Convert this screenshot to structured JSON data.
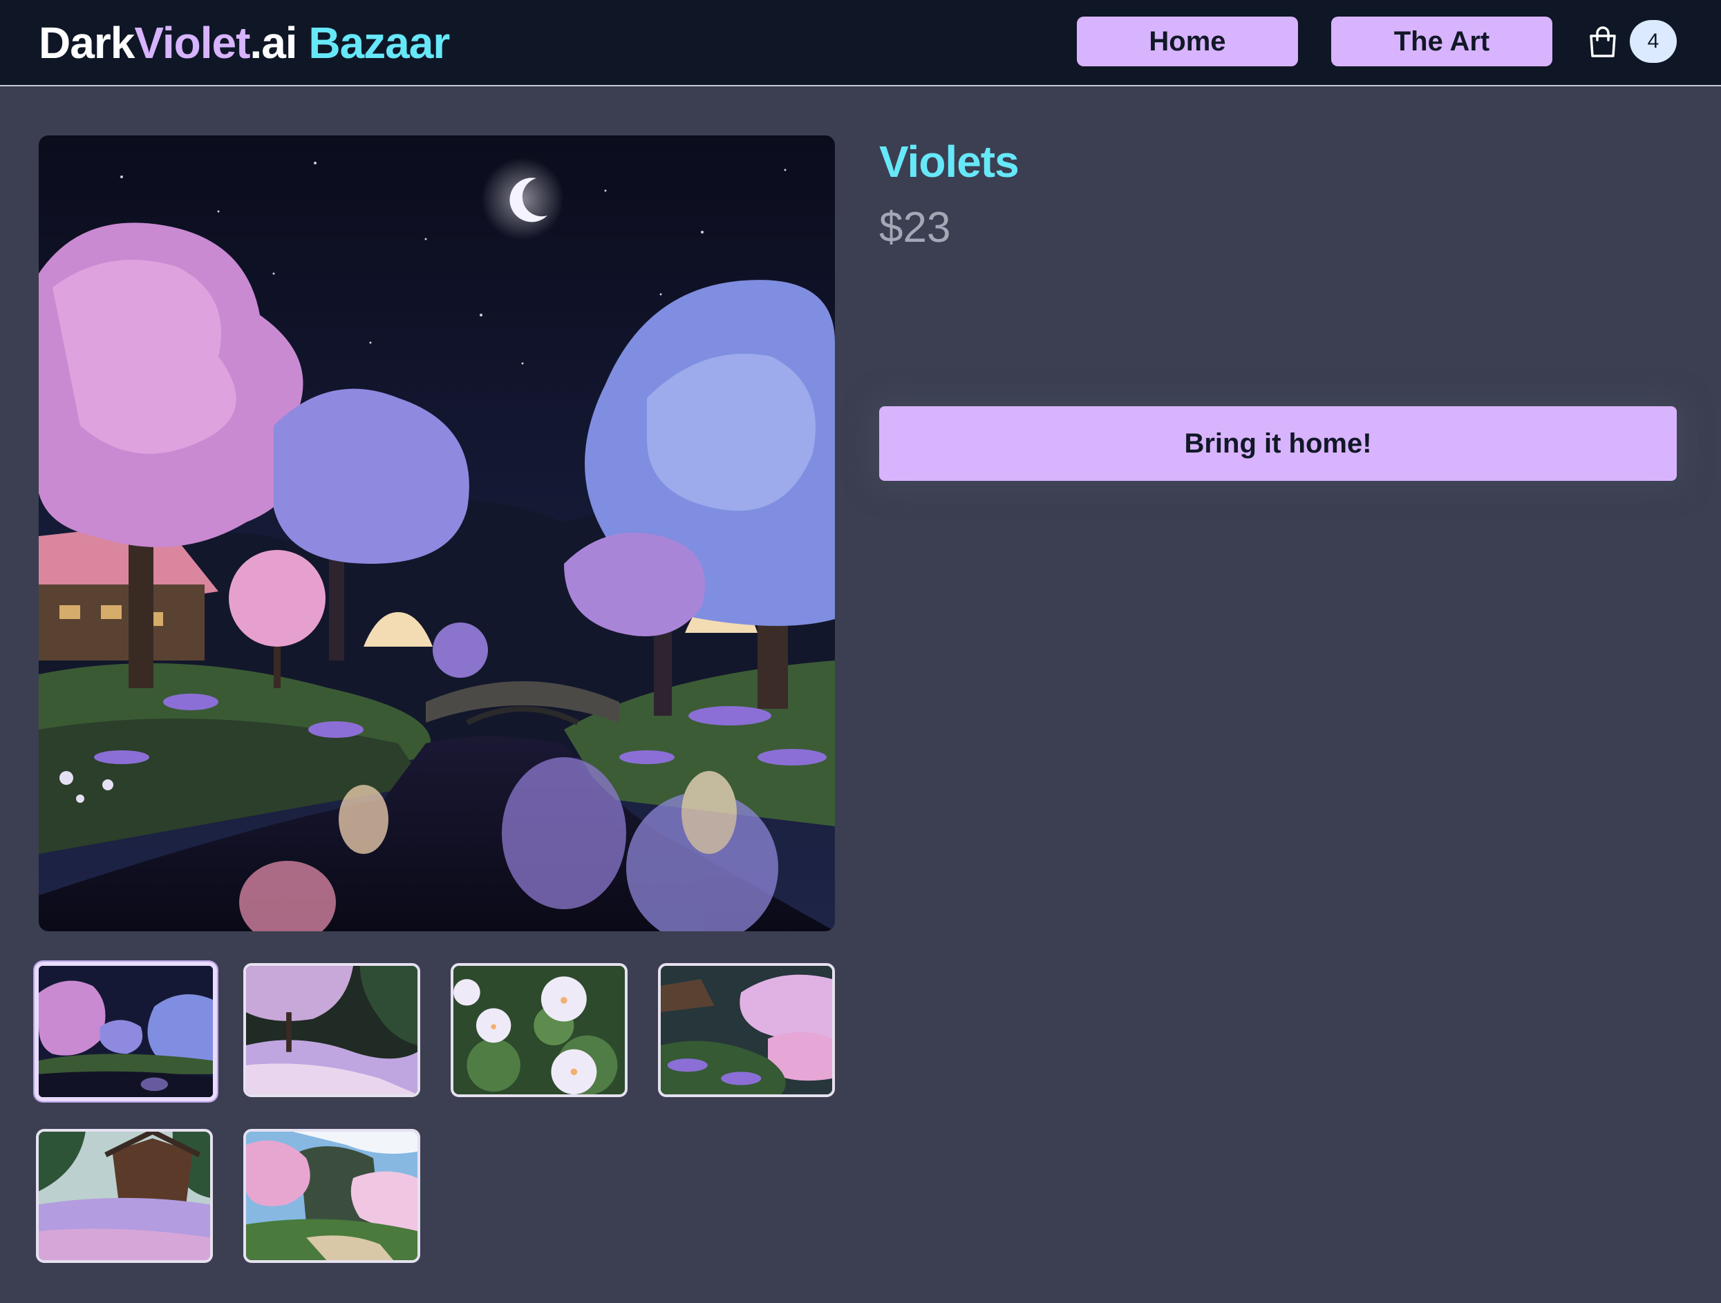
{
  "brand": {
    "part1": "Dark",
    "part2": "Violet",
    "part3": ".ai",
    "part4": "Bazaar"
  },
  "nav": {
    "home_label": "Home",
    "art_label": "The Art"
  },
  "cart": {
    "icon": "shopping-bag-icon",
    "count": "4"
  },
  "product": {
    "title": "Violets",
    "price": "$23",
    "cta_label": "Bring it home!"
  },
  "gallery": {
    "selected_index": 0,
    "thumbnail_count": 6
  },
  "colors": {
    "accent": "#d8b4fe",
    "title_cyan": "#67e8f9",
    "header_bg": "#0f1726",
    "page_bg": "#3b3f51",
    "price_gray": "#a3a8b7"
  }
}
